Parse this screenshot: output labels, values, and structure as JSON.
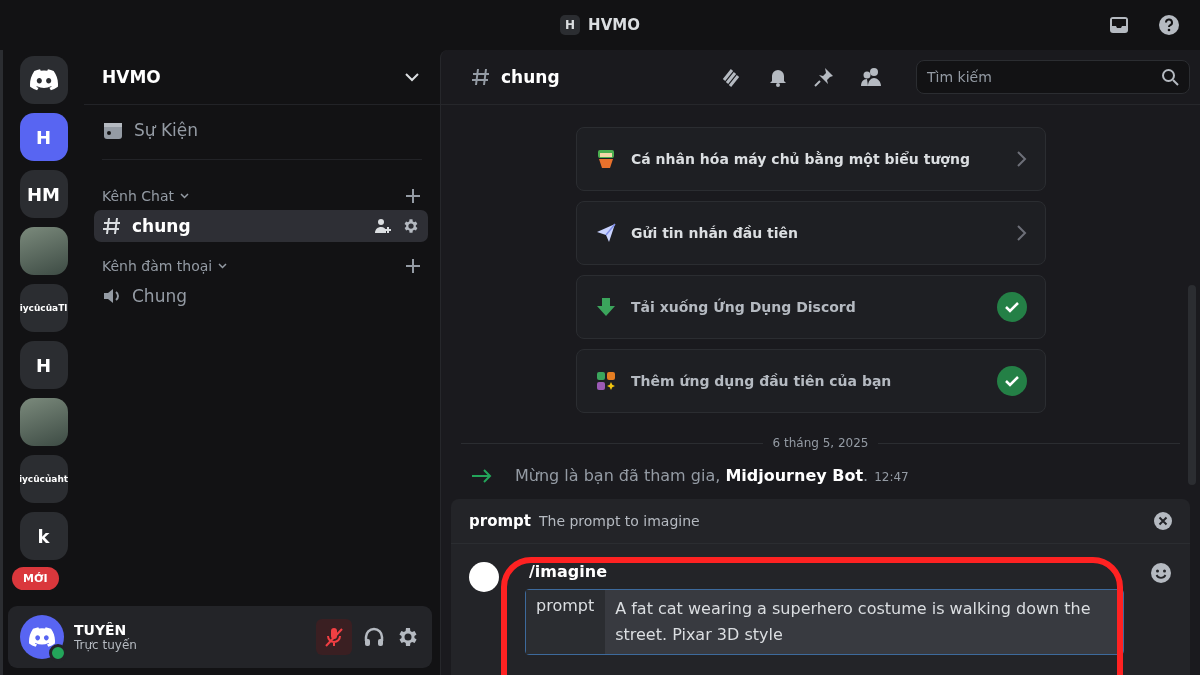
{
  "title_bar": {
    "server_initial": "H",
    "title": "HVMO"
  },
  "servers": [
    {
      "kind": "home",
      "selected": false
    },
    {
      "kind": "initial",
      "label": "H",
      "selected": true
    },
    {
      "kind": "initial",
      "label": "HM",
      "selected": false
    },
    {
      "kind": "photo",
      "selected": false
    },
    {
      "kind": "text",
      "label": "iycûcûaTl",
      "selected": false
    },
    {
      "kind": "initial",
      "label": "H",
      "selected": false
    },
    {
      "kind": "photo",
      "selected": false
    },
    {
      "kind": "text",
      "label": "iycûcủaht",
      "selected": false
    },
    {
      "kind": "initial",
      "label": "k",
      "selected": false
    }
  ],
  "new_badge": "MỚI",
  "sidebar": {
    "server_name": "HVMO",
    "events": "Sự Kiện",
    "categories": [
      {
        "name": "Kênh Chat",
        "channels": [
          {
            "kind": "text",
            "name": "chung",
            "selected": true
          }
        ]
      },
      {
        "name": "Kênh đàm thoại",
        "channels": [
          {
            "kind": "voice",
            "name": "Chung",
            "selected": false
          }
        ]
      }
    ]
  },
  "user_panel": {
    "name": "TUYÊN",
    "status": "Trực tuyến",
    "mic_muted": true
  },
  "channel_header": {
    "name": "chung",
    "search_placeholder": "Tìm kiếm"
  },
  "checklist": [
    {
      "kind": "brush",
      "text": "Cá nhân hóa máy chủ bằng một biểu tượng",
      "done": false
    },
    {
      "kind": "plane",
      "text": "Gửi tin nhắn đầu tiên",
      "done": false
    },
    {
      "kind": "download",
      "text": "Tải xuống Ứng Dụng Discord",
      "done": true
    },
    {
      "kind": "apps",
      "text": "Thêm ứng dụng đầu tiên của bạn",
      "done": true
    }
  ],
  "date_divider": "6 tháng 5, 2025",
  "system_message": {
    "text": "Mừng là bạn đã tham gia, **Midjourney Bot**.",
    "time": "12:47"
  },
  "command": {
    "option": "prompt",
    "description": "The prompt to imagine",
    "name": "/imagine",
    "field_label": "prompt",
    "value": "A fat cat wearing a superhero costume is walking down the street. Pixar 3D style"
  }
}
